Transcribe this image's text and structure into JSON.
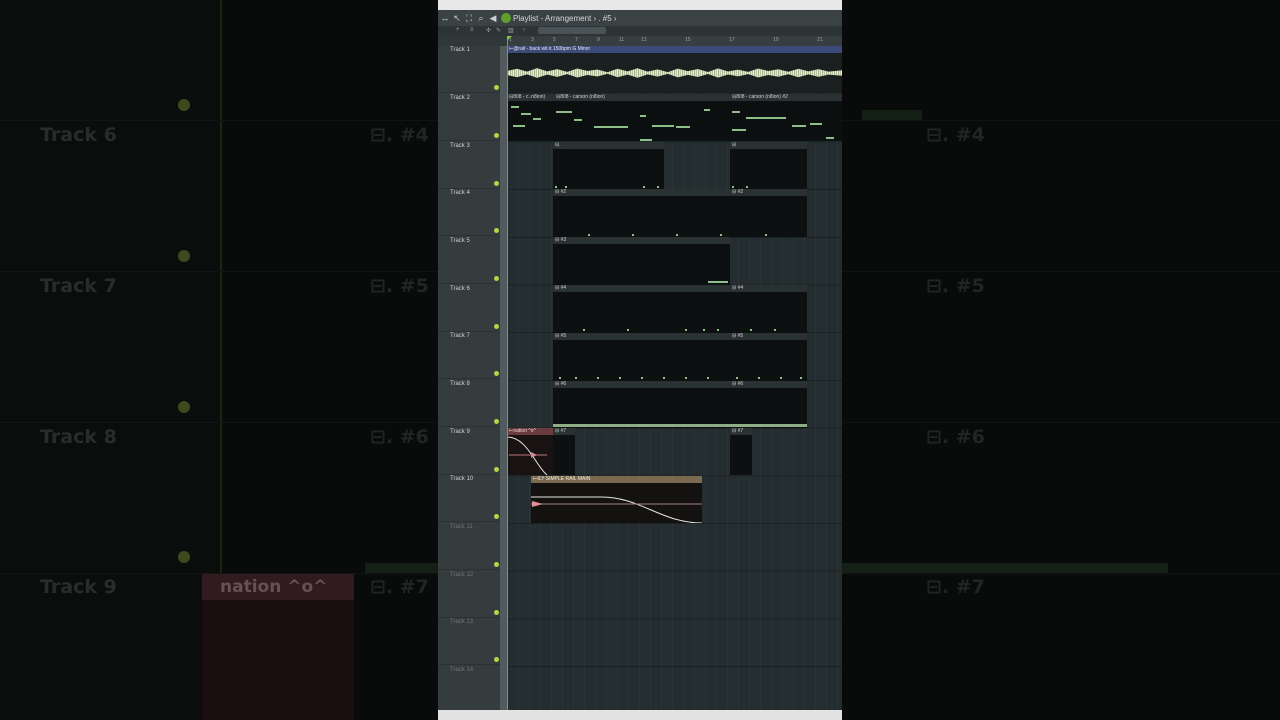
{
  "window": {
    "title": "Playlist - Arrangement › . #5 ›"
  },
  "ruler": {
    "ticks": [
      "1",
      "3",
      "5",
      "7",
      "9",
      "11",
      "13",
      "15",
      "17",
      "19",
      "21"
    ]
  },
  "tracks": [
    {
      "name": "Track 1"
    },
    {
      "name": "Track 2"
    },
    {
      "name": "Track 3"
    },
    {
      "name": "Track 4"
    },
    {
      "name": "Track 5"
    },
    {
      "name": "Track 6"
    },
    {
      "name": "Track 7"
    },
    {
      "name": "Track 8"
    },
    {
      "name": "Track 9"
    },
    {
      "name": "Track 10"
    },
    {
      "name": "Track 11"
    },
    {
      "name": "Track 12"
    },
    {
      "name": "Track 13"
    },
    {
      "name": "Track 14"
    }
  ],
  "clips": {
    "audio_main": "@rail - back wit it 150bpm G Minor",
    "bass_a": "808 - c..n8ion)",
    "bass_b": "808 - carson (n8ion)",
    "bass_c": "808 - carson (n8ion) #2",
    "p_t3_a": ".",
    "p_t3_b": "",
    "p_t4_a": "#2",
    "p_t4_b": "#2",
    "p_t5_a": "#3",
    "p_t6_a": "#4",
    "p_t6_b": "#4",
    "p_t7_a": "#5",
    "p_t7_b": "#5",
    "p_t8_a": "#6",
    "p_t8_b": "#6",
    "p_t9_a": "#7",
    "p_t9_b": "#7",
    "auto_nation": "nation ^o^",
    "auto_main": "ILY SIMPLE RAIL MAIN"
  },
  "backdrop": {
    "left_labels": [
      "Track 6",
      "Track 7",
      "Track 8",
      "Track 9"
    ],
    "left_clips": [
      "#4",
      "#5",
      "#6",
      "#7"
    ],
    "left_auto": "nation ^o^",
    "right_clips": [
      "#4",
      "#5",
      "#6",
      "#7"
    ]
  },
  "colors": {
    "accent_green": "#b4d64a",
    "audio_clip": "#3b4a78",
    "automation_clip": "#6b3b40",
    "automation_clip_2": "#7a6a52"
  }
}
